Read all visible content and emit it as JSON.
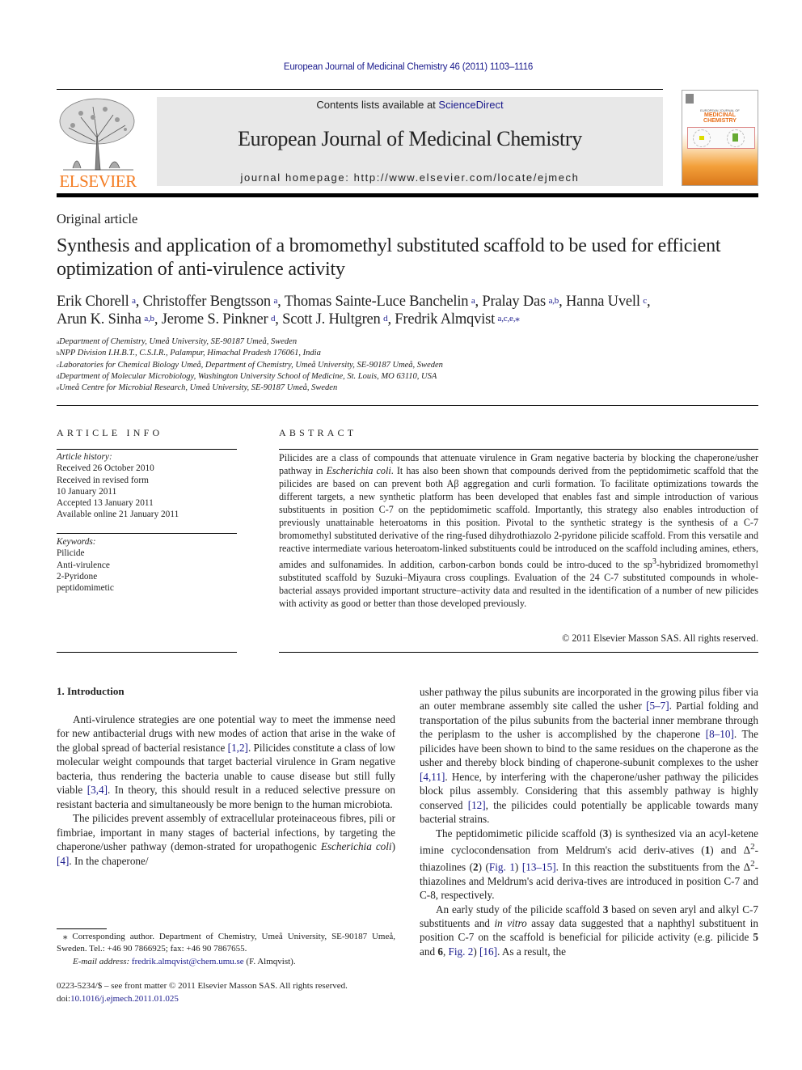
{
  "header": {
    "running_head": "European Journal of Medicinal Chemistry 46 (2011) 1103–1116",
    "publisher_logo_text": "ELSEVIER",
    "contents_prefix": "Contents lists available at ",
    "contents_link": "ScienceDirect",
    "journal_title": "European Journal of Medicinal Chemistry",
    "homepage": "journal homepage: http://www.elsevier.com/locate/ejmech",
    "cover": {
      "small_title": "EUROPEAN JOURNAL OF",
      "big_title_1": "MEDICINAL",
      "big_title_2": "CHEMISTRY"
    },
    "colors": {
      "link": "#1a1a8c",
      "elsevier_orange": "#f47b20",
      "banner_bg": "#e8e8e8"
    }
  },
  "article": {
    "type": "Original article",
    "title": "Synthesis and application of a bromomethyl substituted scaffold to be used for efficient optimization of anti-virulence activity",
    "authors": [
      {
        "name": "Erik Chorell",
        "aff": "a",
        "sep": ", "
      },
      {
        "name": "Christoffer Bengtsson",
        "aff": "a",
        "sep": ", "
      },
      {
        "name": "Thomas Sainte-Luce Banchelin",
        "aff": "a",
        "sep": ", "
      },
      {
        "name": "Pralay Das",
        "aff": "a,b",
        "sep": ", "
      },
      {
        "name": "Hanna Uvell",
        "aff": "c",
        "sep": ","
      },
      {
        "name": "Arun K. Sinha",
        "aff": "a,b",
        "sep": ", "
      },
      {
        "name": "Jerome S. Pinkner",
        "aff": "d",
        "sep": ", "
      },
      {
        "name": "Scott J. Hultgren",
        "aff": "d",
        "sep": ", "
      },
      {
        "name": "Fredrik Almqvist",
        "aff": "a,c,e,⁎",
        "sep": ""
      }
    ],
    "affiliations": [
      {
        "key": "a",
        "text": "Department of Chemistry, Umeå University, SE-90187 Umeå, Sweden"
      },
      {
        "key": "b",
        "text": "NPP Division I.H.B.T., C.S.I.R., Palampur, Himachal Pradesh 176061, India"
      },
      {
        "key": "c",
        "text": "Laboratories for Chemical Biology Umeå, Department of Chemistry, Umeå University, SE-90187 Umeå, Sweden"
      },
      {
        "key": "d",
        "text": "Department of Molecular Microbiology, Washington University School of Medicine, St. Louis, MO 63110, USA"
      },
      {
        "key": "e",
        "text": "Umeå Centre for Microbial Research, Umeå University, SE-90187 Umeå, Sweden"
      }
    ]
  },
  "article_info": {
    "heading": "ARTICLE INFO",
    "history_label": "Article history:",
    "history": [
      "Received 26 October 2010",
      "Received in revised form",
      "10 January 2011",
      "Accepted 13 January 2011",
      "Available online 21 January 2011"
    ],
    "keywords_label": "Keywords:",
    "keywords": [
      "Pilicide",
      "Anti-virulence",
      "2-Pyridone",
      "peptidomimetic"
    ]
  },
  "abstract": {
    "heading": "ABSTRACT",
    "parts": {
      "p1": "Pilicides are a class of compounds that attenuate virulence in Gram negative bacteria by blocking the chaperone/usher pathway in ",
      "p1_it": "Escherichia coli",
      "p2": ". It has also been shown that compounds derived from the peptidomimetic scaffold that the pilicides are based on can prevent both Aβ aggregation and curli formation. To facilitate optimizations towards the different targets, a new synthetic platform has been developed that enables fast and simple introduction of various substituents in position C-7 on the peptidomimetic scaffold. Importantly, this strategy also enables introduction of previously unattainable heteroatoms in this position. Pivotal to the synthetic strategy is the synthesis of a C-7 bromomethyl substituted derivative of the ring-fused dihydrothiazolo 2-pyridone pilicide scaffold. From this versatile and reactive intermediate various heteroatom-linked substituents could be introduced on the scaffold including amines, ethers, amides and sulfonamides. In addition, carbon-carbon bonds could be intro-duced to the sp",
      "p2_sup": "3",
      "p3": "-hybridized bromomethyl substituted scaffold by Suzuki–Miyaura cross couplings. Evaluation of the 24 C-7 substituted compounds in whole-bacterial assays provided important structure–activity data and resulted in the identification of a number of new pilicides with activity as good or better than those developed previously."
    },
    "copyright": "© 2011 Elsevier Masson SAS. All rights reserved."
  },
  "body": {
    "intro_heading": "1.  Introduction",
    "left": {
      "p1a": "Anti-virulence strategies are one potential way to meet the immense need for new antibacterial drugs with new modes of action that arise in the wake of the global spread of bacterial resistance ",
      "p1_ref1": "[1,2]",
      "p1b": ". Pilicides constitute a class of low molecular weight compounds that target bacterial virulence in Gram negative bacteria, thus rendering the bacteria unable to cause disease but still fully viable ",
      "p1_ref2": "[3,4]",
      "p1c": ". In theory, this should result in a reduced selective pressure on resistant bacteria and simultaneously be more benign to the human microbiota.",
      "p2a": "The pilicides prevent assembly of extracellular proteinaceous fibres, pili or fimbriae, important in many stages of bacterial infections, by targeting the chaperone/usher pathway (demon-strated for uropathogenic ",
      "p2_it": "Escherichia coli",
      "p2b": ") ",
      "p2_ref": "[4]",
      "p2c": ". In the chaperone/"
    },
    "right": {
      "p1a": "usher pathway the pilus subunits are incorporated in the growing pilus fiber via an outer membrane assembly site called the usher ",
      "p1_ref1": "[5–7]",
      "p1b": ". Partial folding and transportation of the pilus subunits from the bacterial inner membrane through the periplasm to the usher is accomplished by the chaperone ",
      "p1_ref2": "[8–10]",
      "p1c": ". The pilicides have been shown to bind to the same residues on the chaperone as the usher and thereby block binding of chaperone-subunit complexes to the usher ",
      "p1_ref3": "[4,11]",
      "p1d": ". Hence, by interfering with the chaperone/usher pathway the pilicides block pilus assembly. Considering that this assembly pathway is highly conserved ",
      "p1_ref4": "[12]",
      "p1e": ", the pilicides could potentially be applicable towards many bacterial strains.",
      "p2a": "The peptidomimetic pilicide scaffold (",
      "p2_b1": "3",
      "p2b": ") is synthesized via an acyl-ketene imine cyclocondensation from Meldrum's acid deriv-atives (",
      "p2_b2": "1",
      "p2c": ") and Δ",
      "p2_sup1": "2",
      "p2d": "-thiazolines (",
      "p2_b3": "2",
      "p2e": ") (",
      "p2_fig": "Fig. 1",
      "p2f": ") ",
      "p2_ref": "[13–15]",
      "p2g": ". In this reaction the substituents from the Δ",
      "p2_sup2": "2",
      "p2h": "-thiazolines and Meldrum's acid deriva-tives are introduced in position C-7 and C-8, respectively.",
      "p3a": "An early study of the pilicide scaffold ",
      "p3_b1": "3",
      "p3b": " based on seven aryl and alkyl C-7 substituents and ",
      "p3_it": "in vitro",
      "p3c": " assay data suggested that a naphthyl substituent in position C-7 on the scaffold is beneficial for pilicide activity (e.g. pilicide ",
      "p3_b2": "5",
      "p3d": " and ",
      "p3_b3": "6",
      "p3e": ", ",
      "p3_fig": "Fig. 2",
      "p3f": ") ",
      "p3_ref": "[16]",
      "p3g": ". As a result, the"
    }
  },
  "footnotes": {
    "corresponding": "⁎ Corresponding author. Department of Chemistry, Umeå University, SE-90187 Umeå, Sweden. Tel.: +46 90 7866925; fax: +46 90 7867655.",
    "email_label": "E-mail address: ",
    "email": "fredrik.almqvist@chem.umu.se",
    "email_suffix": " (F. Almqvist).",
    "front_matter": "0223-5234/$ – see front matter © 2011 Elsevier Masson SAS. All rights reserved.",
    "doi_label": "doi:",
    "doi": "10.1016/j.ejmech.2011.01.025"
  }
}
